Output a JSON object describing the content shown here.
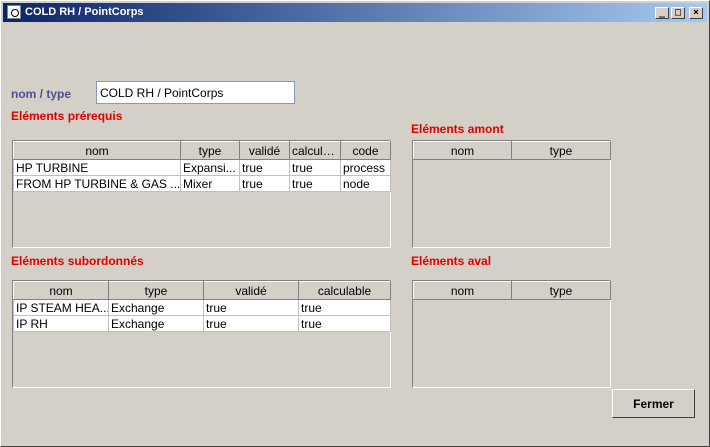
{
  "window": {
    "title": "COLD RH / PointCorps",
    "controls": {
      "minimize": "_",
      "maximize": "□",
      "close": "×"
    }
  },
  "form": {
    "name_label": "nom / type",
    "name_value": "COLD RH / PointCorps"
  },
  "prerequis": {
    "title": "Eléments prérequis",
    "columns": [
      "nom",
      "type",
      "validé",
      "calcula...",
      "code"
    ],
    "rows": [
      [
        "HP TURBINE",
        "Expansi...",
        "true",
        "true",
        "process"
      ],
      [
        "FROM HP TURBINE & GAS ...",
        "Mixer",
        "true",
        "true",
        "node"
      ]
    ]
  },
  "amont": {
    "title": "Eléments amont",
    "columns": [
      "nom",
      "type"
    ],
    "rows": []
  },
  "subordonnes": {
    "title": "Eléments subordonnés",
    "columns": [
      "nom",
      "type",
      "validé",
      "calculable"
    ],
    "rows": [
      [
        "IP STEAM HEA...",
        "Exchange",
        "true",
        "true"
      ],
      [
        "IP RH",
        "Exchange",
        "true",
        "true"
      ]
    ]
  },
  "aval": {
    "title": "Eléments aval",
    "columns": [
      "nom",
      "type"
    ],
    "rows": []
  },
  "buttons": {
    "close": "Fermer"
  }
}
